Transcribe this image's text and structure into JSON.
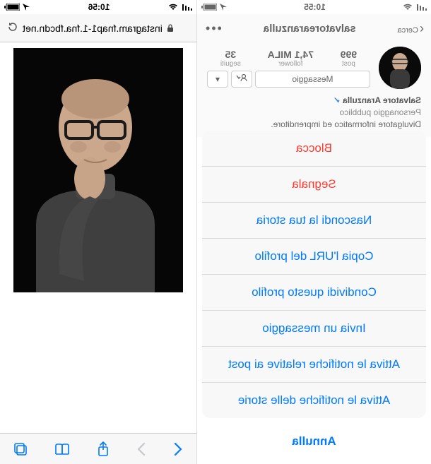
{
  "status": {
    "time_left": "10:55",
    "time_right": "10:56"
  },
  "profile": {
    "nav_back": "Cerca",
    "username": "salvatorearanzulla",
    "stats": {
      "posts_val": "999",
      "posts_lbl": "post",
      "followers_val": "74,1 MILA",
      "followers_lbl": "follower",
      "following_val": "35",
      "following_lbl": "seguiti"
    },
    "message_btn": "Messaggio",
    "bio_name": "Salvatore Aranzulla",
    "bio_role": "Personaggio pubblico",
    "bio_desc": "Divulgatore informatico ed imprenditore."
  },
  "sheet": {
    "block": "Blocca",
    "report": "Segnala",
    "hide_story": "Nascondi la tua storia",
    "copy_url": "Copia l'URL del profilo",
    "share_profile": "Condividi questo profilo",
    "send_message": "Invia un messaggio",
    "enable_post_notif": "Attiva le notifiche relative ai post",
    "enable_story_notif": "Attiva le notifiche delle storie",
    "cancel": "Annulla"
  },
  "safari": {
    "domain": "instagram.fnap1-1.fna.fbcdn.net"
  }
}
